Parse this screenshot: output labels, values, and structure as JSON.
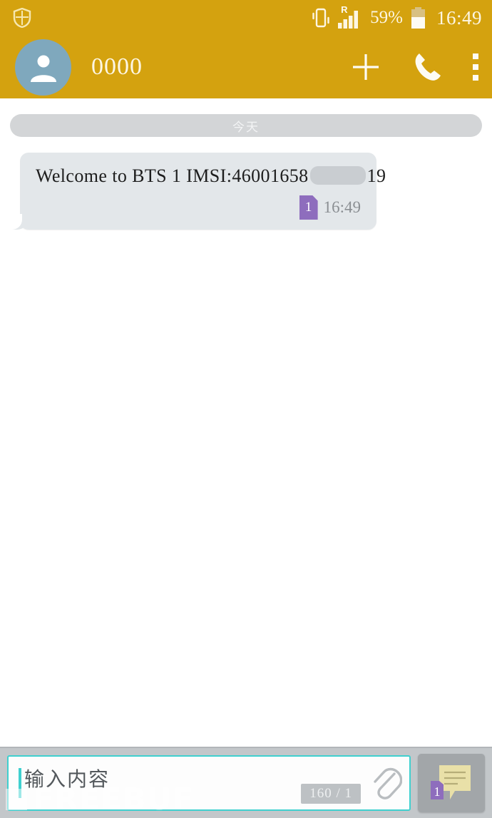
{
  "status_bar": {
    "shield_icon": "shield-icon",
    "vibrate_icon": "vibrate-icon",
    "roaming_label": "R",
    "signal_icon": "signal-bars-icon",
    "battery_percent": "59%",
    "battery_icon": "battery-icon",
    "clock": "16:49",
    "background_color": "#d4a20f"
  },
  "action_bar": {
    "avatar_icon": "contact-avatar-icon",
    "peer_name": "0000",
    "add_icon": "plus-icon",
    "call_icon": "phone-call-icon",
    "overflow_icon": "more-vertical-icon",
    "background_color": "#d4a20f"
  },
  "thread": {
    "date_divider": "今天",
    "messages": [
      {
        "text_before_redaction": "Welcome  to  BTS  1  IMSI:46001658",
        "redacted": true,
        "text_after_redaction": "19",
        "sim_badge": "1",
        "time": "16:49",
        "bubble_color": "#e3e7ea",
        "sim_badge_color": "#8e6dbd"
      }
    ]
  },
  "composer": {
    "input_value": "",
    "placeholder": "输入内容",
    "counter": "160 / 1",
    "attach_icon": "paperclip-icon",
    "send_icon": "send-sms-sim1-icon",
    "send_sim_badge": "1",
    "border_color": "#3fd0cf",
    "background_color": "#c3c7ca"
  },
  "watermark": {
    "text": "FREEBUF"
  }
}
